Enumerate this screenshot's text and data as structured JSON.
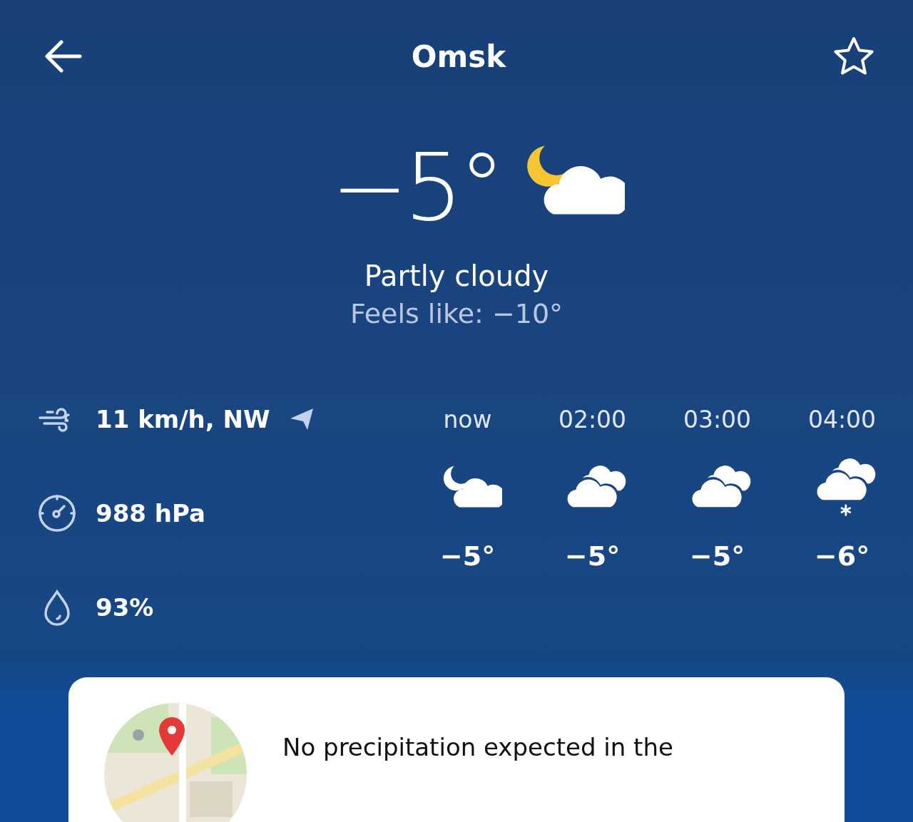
{
  "header": {
    "title": "Omsk",
    "favorite": false
  },
  "current": {
    "temperature": "−5°",
    "kind": "moon-cloud",
    "condition": "Partly cloudy",
    "feels_like": "Feels like: −10°"
  },
  "details": [
    {
      "kind": "wind",
      "value": "11 km/h, NW"
    },
    {
      "kind": "pressure",
      "value": "988 hPa"
    },
    {
      "kind": "humidity",
      "value": "93%"
    }
  ],
  "hourly": [
    {
      "time": "now",
      "kind": "moon-cloud",
      "temperature": "−5°"
    },
    {
      "time": "02:00",
      "kind": "cloudy",
      "temperature": "−5°"
    },
    {
      "time": "03:00",
      "kind": "cloudy",
      "temperature": "−5°"
    },
    {
      "time": "04:00",
      "kind": "cloudy-snow",
      "temperature": "−6°"
    }
  ],
  "nowcast": {
    "message": "No precipitation expected in the"
  }
}
